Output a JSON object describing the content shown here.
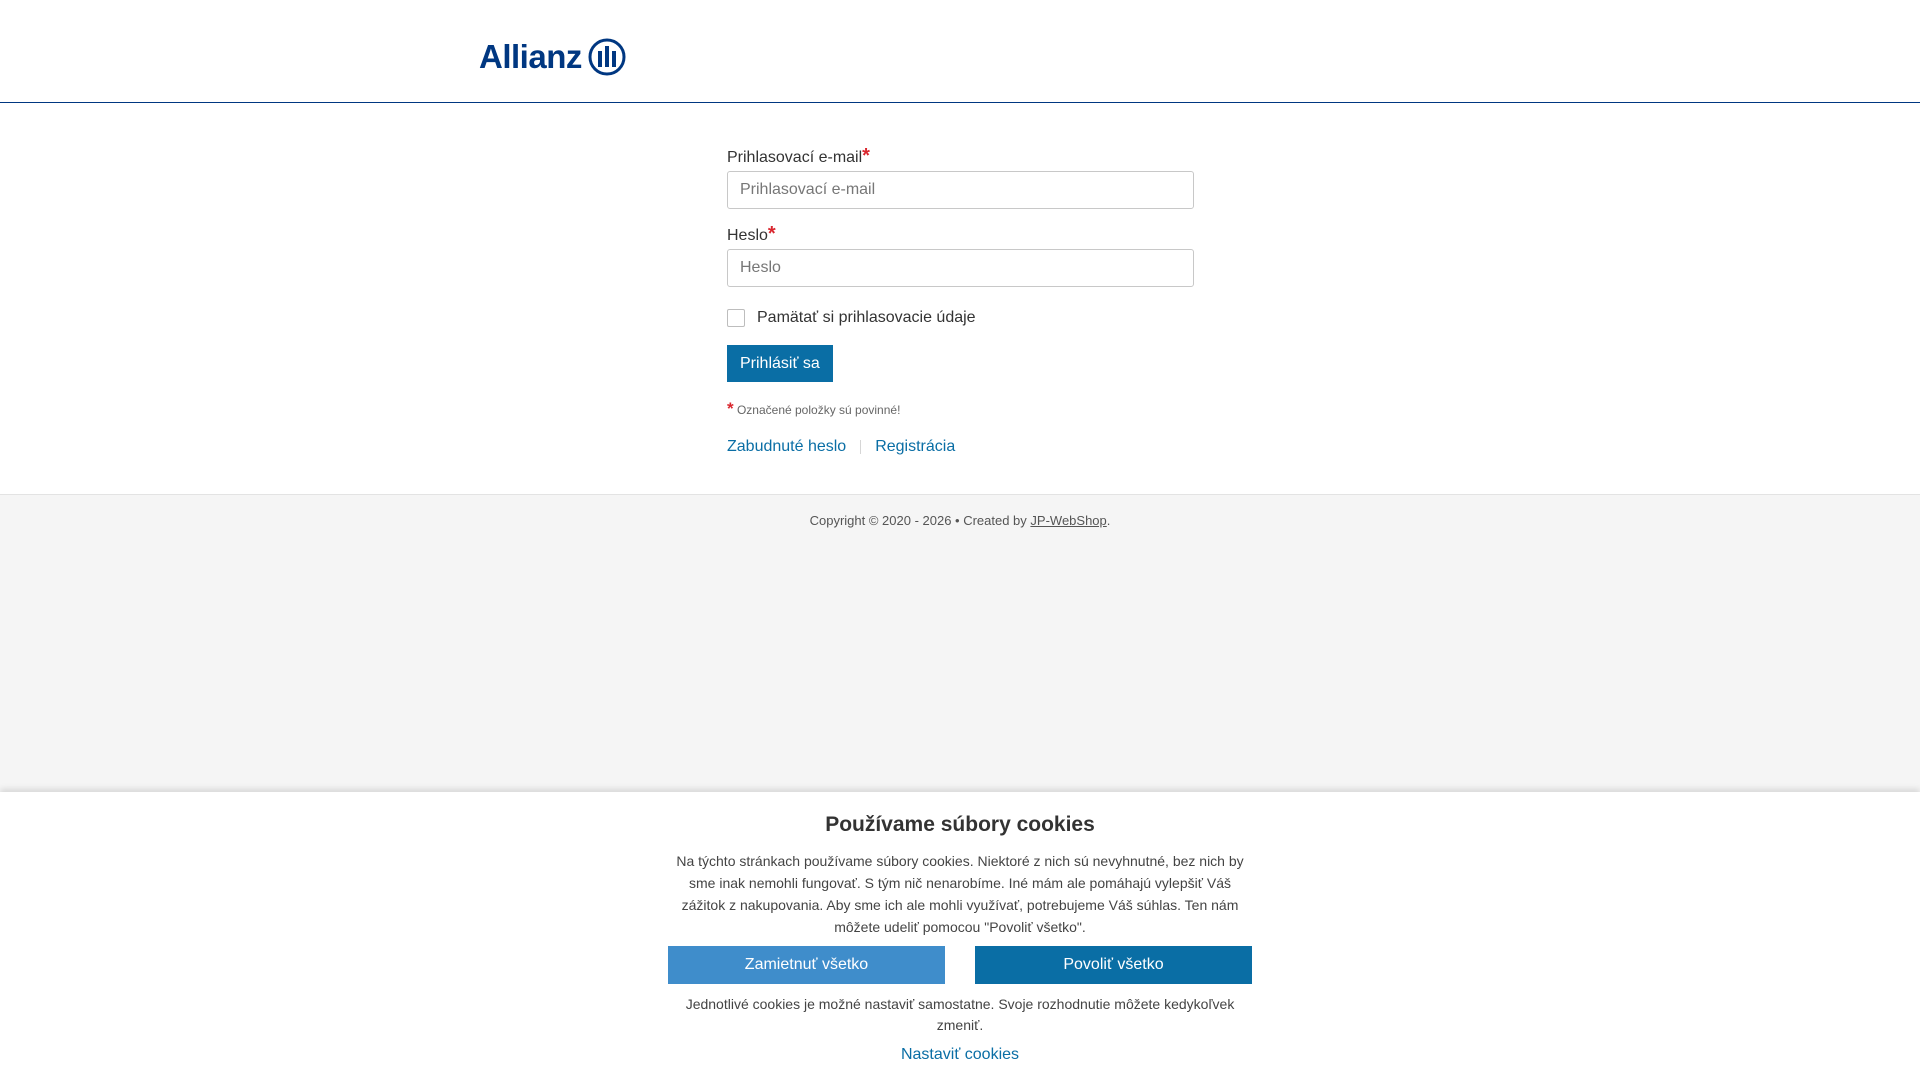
{
  "header": {
    "logo_text": "Allianz"
  },
  "form": {
    "email_label": "Prihlasovací e-mail",
    "email_placeholder": "Prihlasovací e-mail",
    "email_value": "",
    "required_mark": "*",
    "password_label": "Heslo",
    "password_placeholder": "Heslo",
    "password_value": "",
    "remember_label": "Pamätať si prihlasovacie údaje",
    "remember_checked": false,
    "login_button": "Prihlásiť sa",
    "required_note": "Označené položky sú povinné!",
    "forgot_password_link": "Zabudnuté heslo",
    "register_link": "Registrácia"
  },
  "footer": {
    "copyright_prefix": "Copyright © 2020 - 2026 • Created by ",
    "creator_link": "JP-WebShop",
    "copyright_suffix": "."
  },
  "cookies": {
    "title": "Používame súbory cookies",
    "text": "Na týchto stránkach používame súbory cookies. Niektoré z nich sú nevyhnutné, bez nich by sme inak nemohli fungovať. S tým nič nenarobíme. Iné mám ale pomáhajú vylepšiť Váš zážitok z nakupovania. Aby sme ich ale mohli využívať, potrebujeme Váš súhlas. Ten nám môžete udeliť pomocou \"Povoliť všetko\".",
    "reject_button": "Zamietnuť všetko",
    "accept_button": "Povoliť všetko",
    "sub_text": "Jednotlivé cookies je možné nastaviť samostatne. Svoje rozhodnutie môžete kedykoľvek zmeniť.",
    "settings_link": "Nastaviť cookies"
  },
  "colors": {
    "brand": "#003781",
    "primary_button": "#0a6ea5",
    "secondary_button": "#3f8dcb",
    "required": "#d9262e"
  },
  "icons": {
    "logo_mark": "allianz-eagle-icon"
  }
}
